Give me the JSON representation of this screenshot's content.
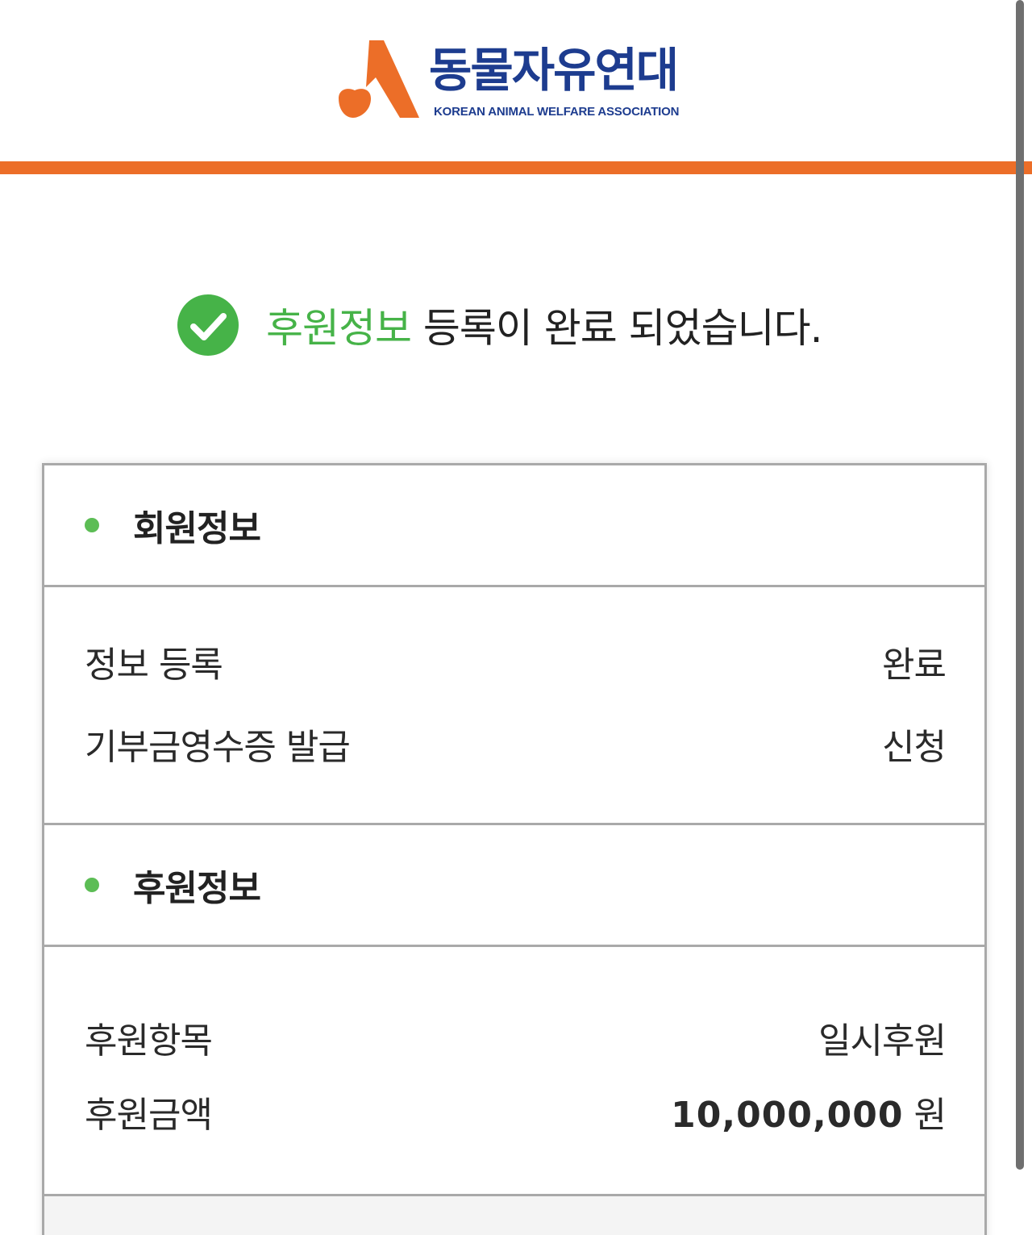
{
  "brand": {
    "name_korean": "동물자유연대",
    "name_english": "KOREAN ANIMAL WELFARE ASSOCIATION",
    "colors": {
      "orange": "#ec6e28",
      "navy": "#1d3c8f",
      "green": "#46b348"
    }
  },
  "complete": {
    "highlight": "후원정보",
    "message": " 등록이 완료 되었습니다."
  },
  "member_section": {
    "title": "회원정보",
    "rows": [
      {
        "label": "정보 등록",
        "value": "완료"
      },
      {
        "label": "기부금영수증 발급",
        "value": "신청"
      }
    ]
  },
  "support_section": {
    "title": "후원정보",
    "rows": [
      {
        "label": "후원항목",
        "value": "일시후원"
      },
      {
        "label": "후원금액",
        "amount": "10,000,000",
        "unit": " 원"
      }
    ]
  }
}
